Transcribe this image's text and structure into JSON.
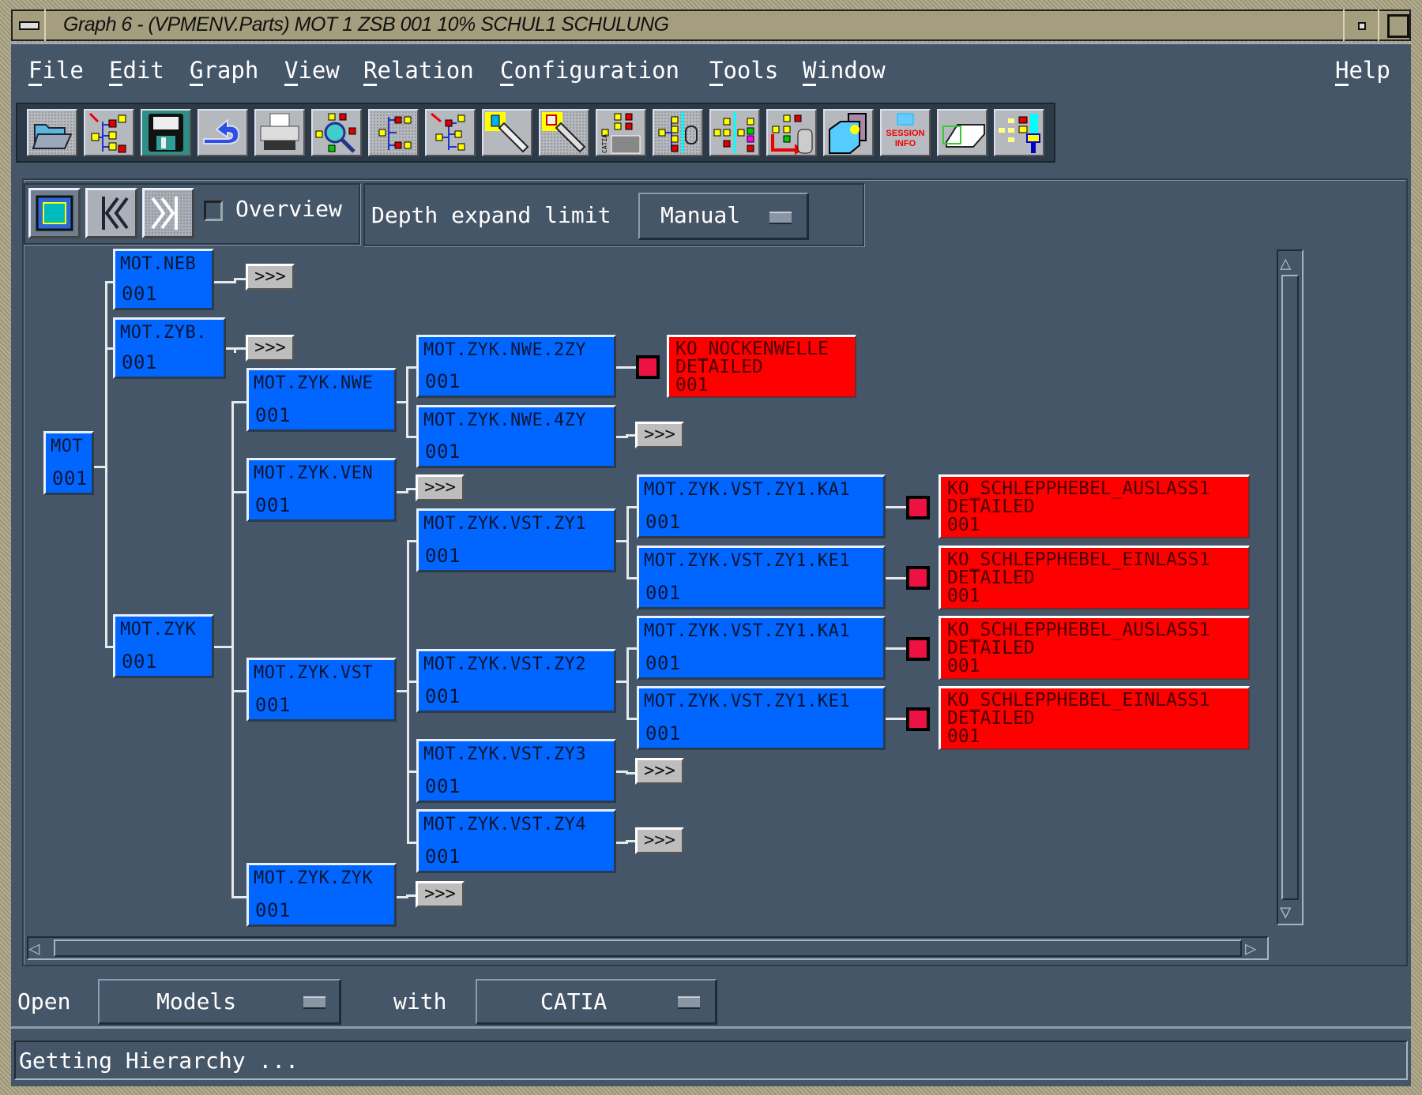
{
  "window": {
    "title": "Graph 6 - (VPMENV.Parts) MOT 1 ZSB  001 10% SCHUL1 SCHULUNG"
  },
  "menu": {
    "items": [
      "File",
      "Edit",
      "Graph",
      "View",
      "Relation",
      "Configuration",
      "Tools",
      "Window"
    ],
    "help": "Help"
  },
  "toolbar": {
    "buttons": [
      {
        "icon": "open-folder-icon"
      },
      {
        "icon": "expand-tree-icon"
      },
      {
        "icon": "save-floppy-icon"
      },
      {
        "icon": "undo-arrow-icon"
      },
      {
        "icon": "printer-icon"
      },
      {
        "icon": "tree-search-icon"
      },
      {
        "icon": "tree-collapse-icon"
      },
      {
        "icon": "tree-expand-red-icon"
      },
      {
        "icon": "flashlight-icon"
      },
      {
        "icon": "flashlight-dotted-icon"
      },
      {
        "icon": "catia-tree-icon"
      },
      {
        "icon": "tree-filter-icon"
      },
      {
        "icon": "tree-compare-icon"
      },
      {
        "icon": "tree-export-icon"
      },
      {
        "icon": "3d-box-icon"
      },
      {
        "icon": "session-info-icon",
        "label_top": "SESSION",
        "label_bottom": "INFO"
      },
      {
        "icon": "part-wireframe-icon"
      },
      {
        "icon": "tree-paint-icon"
      }
    ]
  },
  "controls": {
    "overview_label": "Overview",
    "overview_checked": false,
    "depth_label": "Depth expand limit",
    "depth_value": "Manual"
  },
  "graph": {
    "expand_label": ">>>",
    "nodes": {
      "mot": {
        "name": "MOT",
        "version": "001"
      },
      "neb": {
        "name": "MOT.NEB",
        "version": "001"
      },
      "zyb": {
        "name": "MOT.ZYB.",
        "version": "001"
      },
      "zyk": {
        "name": "MOT.ZYK",
        "version": "001"
      },
      "zyk_nwe": {
        "name": "MOT.ZYK.NWE",
        "version": "001"
      },
      "zyk_ven": {
        "name": "MOT.ZYK.VEN",
        "version": "001"
      },
      "zyk_vst": {
        "name": "MOT.ZYK.VST",
        "version": "001"
      },
      "zyk_zyk": {
        "name": "MOT.ZYK.ZYK",
        "version": "001"
      },
      "nwe_2zy": {
        "name": "MOT.ZYK.NWE.2ZY",
        "version": "001"
      },
      "nwe_4zy": {
        "name": "MOT.ZYK.NWE.4ZY",
        "version": "001"
      },
      "vst_zy1": {
        "name": "MOT.ZYK.VST.ZY1",
        "version": "001"
      },
      "vst_zy2": {
        "name": "MOT.ZYK.VST.ZY2",
        "version": "001"
      },
      "vst_zy3": {
        "name": "MOT.ZYK.VST.ZY3",
        "version": "001"
      },
      "vst_zy4": {
        "name": "MOT.ZYK.VST.ZY4",
        "version": "001"
      },
      "zy1_ka1_a": {
        "name": "MOT.ZYK.VST.ZY1.KA1",
        "version": "001"
      },
      "zy1_ke1_a": {
        "name": "MOT.ZYK.VST.ZY1.KE1",
        "version": "001"
      },
      "zy1_ka1_b": {
        "name": "MOT.ZYK.VST.ZY1.KA1",
        "version": "001"
      },
      "zy1_ke1_b": {
        "name": "MOT.ZYK.VST.ZY1.KE1",
        "version": "001"
      }
    },
    "documents": {
      "nockenwelle": {
        "name": "KO_NOCKENWELLE",
        "type": "DETAILED",
        "version": "001"
      },
      "auslass_a": {
        "name": "KO_SCHLEPPHEBEL_AUSLASS1",
        "type": "DETAILED",
        "version": "001"
      },
      "einlass_a": {
        "name": "KO_SCHLEPPHEBEL_EINLASS1",
        "type": "DETAILED",
        "version": "001"
      },
      "auslass_b": {
        "name": "KO_SCHLEPPHEBEL_AUSLASS1",
        "type": "DETAILED",
        "version": "001"
      },
      "einlass_b": {
        "name": "KO_SCHLEPPHEBEL_EINLASS1",
        "type": "DETAILED",
        "version": "001"
      }
    }
  },
  "bottom": {
    "open_label": "Open",
    "open_value": "Models",
    "with_label": "with",
    "with_value": "CATIA"
  },
  "status": {
    "text": "Getting Hierarchy ..."
  },
  "colors": {
    "background": "#465669",
    "node_blue": "#0066ff",
    "document_red": "#ff0000",
    "leaf_marker": "#ee1144",
    "titlebar": "#a59e7e"
  }
}
